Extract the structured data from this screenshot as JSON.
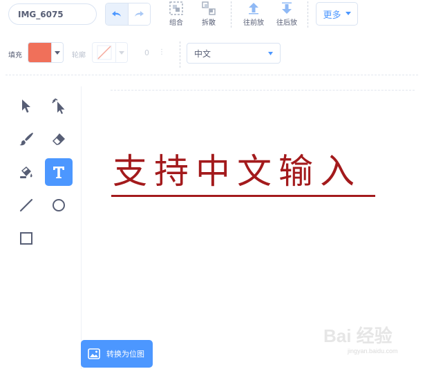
{
  "toolbar": {
    "costume_name": "IMG_6075",
    "group_label": "组合",
    "ungroup_label": "拆散",
    "forward_label": "往前放",
    "backward_label": "往后放",
    "more_label": "更多"
  },
  "props": {
    "fill_label": "填充",
    "fill_color": "#f0705a",
    "outline_label": "轮廓",
    "outline_width": "0",
    "font_value": "中文"
  },
  "tools": [
    {
      "name": "select",
      "icon": "arrow-cursor-icon"
    },
    {
      "name": "reshape",
      "icon": "reshape-cursor-icon"
    },
    {
      "name": "brush",
      "icon": "brush-icon"
    },
    {
      "name": "eraser",
      "icon": "eraser-icon"
    },
    {
      "name": "fill",
      "icon": "paint-bucket-icon"
    },
    {
      "name": "text",
      "icon": "text-icon",
      "selected": true
    },
    {
      "name": "line",
      "icon": "line-icon"
    },
    {
      "name": "circle",
      "icon": "circle-icon"
    },
    {
      "name": "rectangle",
      "icon": "rectangle-icon"
    }
  ],
  "canvas": {
    "text": "支持中文输入",
    "text_color": "#a31a1c"
  },
  "bottom": {
    "convert_label": "转换为位图"
  },
  "watermark": {
    "main": "Bai 经验",
    "sub": "jingyan.baidu.com"
  },
  "colors": {
    "accent": "#4c97ff",
    "text": "#575e75"
  }
}
